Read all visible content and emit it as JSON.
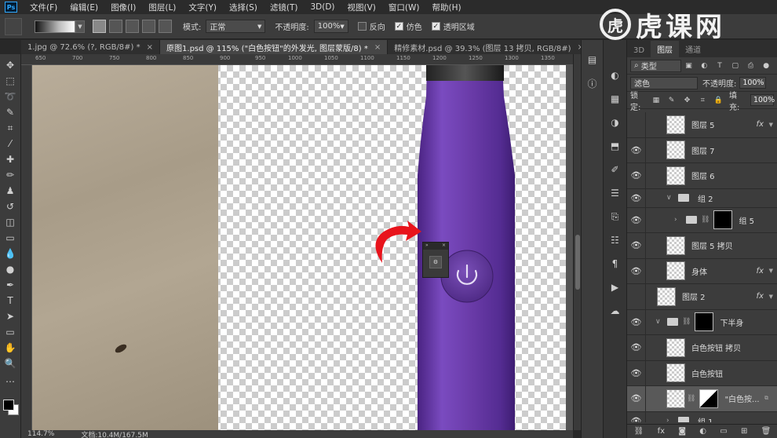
{
  "menu": [
    "文件(F)",
    "编辑(E)",
    "图像(I)",
    "图层(L)",
    "文字(Y)",
    "选择(S)",
    "滤镜(T)",
    "3D(D)",
    "视图(V)",
    "窗口(W)",
    "帮助(H)"
  ],
  "ps_logo": "Ps",
  "watermark": {
    "mark": "虎",
    "text": "虎课网"
  },
  "options": {
    "mode_label": "模式:",
    "mode_value": "正常",
    "opacity_label": "不透明度:",
    "opacity_value": "100%",
    "reverse_label": "反向",
    "dither_label": "仿色",
    "transparency_label": "透明区域"
  },
  "tabs": [
    {
      "label": "1.jpg @ 72.6% (?, RGB/8#) *",
      "active": false
    },
    {
      "label": "原图1.psd @ 115% (\"白色按钮\"的外发光, 图层蒙版/8) *",
      "active": true
    },
    {
      "label": "精修素材.psd @ 39.3% (图层 13 拷贝, RGB/8#)",
      "active": false
    }
  ],
  "ruler_marks": [
    "650",
    "700",
    "750",
    "800",
    "850",
    "900",
    "950",
    "1000",
    "1050",
    "1100",
    "1150",
    "1200",
    "1250",
    "1300",
    "1350"
  ],
  "status": {
    "zoom": "114.7%",
    "doc": "文档:10.4M/167.5M"
  },
  "layers_panel": {
    "tabs": [
      "3D",
      "图层",
      "通道"
    ],
    "filter": "类型",
    "blend": "滤色",
    "opacity_label": "不透明度:",
    "opacity_value": "100%",
    "lock_label": "锁定:",
    "fill_label": "填充:",
    "fill_value": "100%",
    "layers": [
      {
        "name": "图层 5",
        "fx": true,
        "visible": false
      },
      {
        "name": "图层 7",
        "fx": false,
        "visible": true
      },
      {
        "name": "图层 6",
        "fx": false,
        "visible": true
      },
      {
        "name": "组 2",
        "fx": false,
        "visible": true
      },
      {
        "name": "组 5",
        "fx": false,
        "visible": true
      },
      {
        "name": "图层 5 拷贝",
        "fx": false,
        "visible": true
      },
      {
        "name": "身体",
        "fx": true,
        "visible": true
      },
      {
        "name": "图层 2",
        "fx": true,
        "visible": false
      },
      {
        "name": "下半身",
        "fx": false,
        "visible": true
      },
      {
        "name": "白色按钮 拷贝",
        "fx": false,
        "visible": true
      },
      {
        "name": "白色按钮",
        "fx": false,
        "visible": true
      },
      {
        "name": "\"白色按...",
        "fx": false,
        "visible": true
      },
      {
        "name": "组 1",
        "fx": false,
        "visible": true
      }
    ]
  },
  "colors": {
    "purple": "#6a3ba8",
    "arrow": "#e8141c",
    "accent": "#31a8ff"
  }
}
